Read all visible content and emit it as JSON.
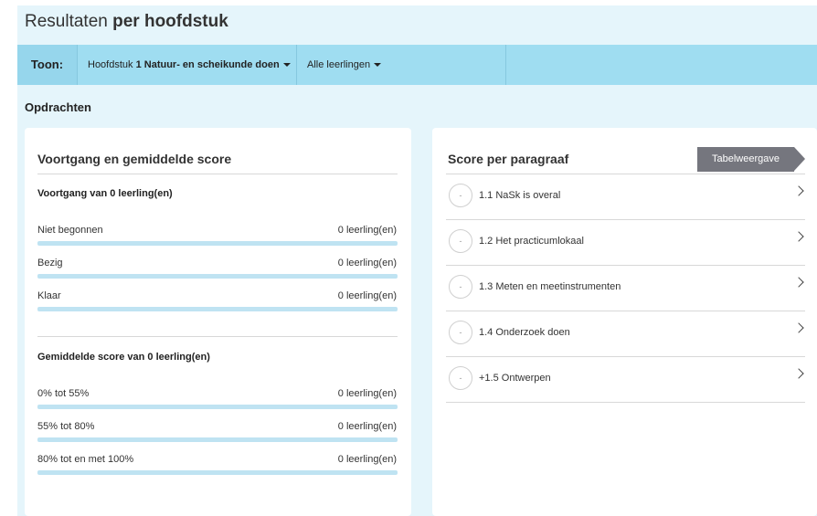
{
  "header": {
    "title_prefix": "Resultaten",
    "title_bold": "per hoofdstuk"
  },
  "toolbar": {
    "toon_label": "Toon:",
    "chapter_prefix": "Hoofdstuk",
    "chapter_selected": "1 Natuur- en scheikunde doen",
    "students_selected": "Alle leerlingen"
  },
  "section_title": "Opdrachten",
  "progress_card": {
    "title": "Voortgang en gemiddelde score",
    "progress_heading": "Voortgang van 0 leerling(en)",
    "progress_rows": [
      {
        "label": "Niet begonnen",
        "value": "0 leerling(en)"
      },
      {
        "label": "Bezig",
        "value": "0 leerling(en)"
      },
      {
        "label": "Klaar",
        "value": "0 leerling(en)"
      }
    ],
    "score_heading": "Gemiddelde score van 0 leerling(en)",
    "score_rows": [
      {
        "label": "0% tot 55%",
        "value": "0 leerling(en)"
      },
      {
        "label": "55% tot 80%",
        "value": "0 leerling(en)"
      },
      {
        "label": "80% tot en met 100%",
        "value": "0 leerling(en)"
      }
    ]
  },
  "paragraph_card": {
    "title": "Score per paragraaf",
    "table_button": "Tabelweergave",
    "items": [
      {
        "score": "-",
        "label": "1.1 NaSk is overal"
      },
      {
        "score": "-",
        "label": "1.2 Het practicumlokaal"
      },
      {
        "score": "-",
        "label": "1.3 Meten en meetinstrumenten"
      },
      {
        "score": "-",
        "label": "1.4 Onderzoek doen"
      },
      {
        "score": "-",
        "label": "+1.5 Ontwerpen"
      }
    ]
  }
}
